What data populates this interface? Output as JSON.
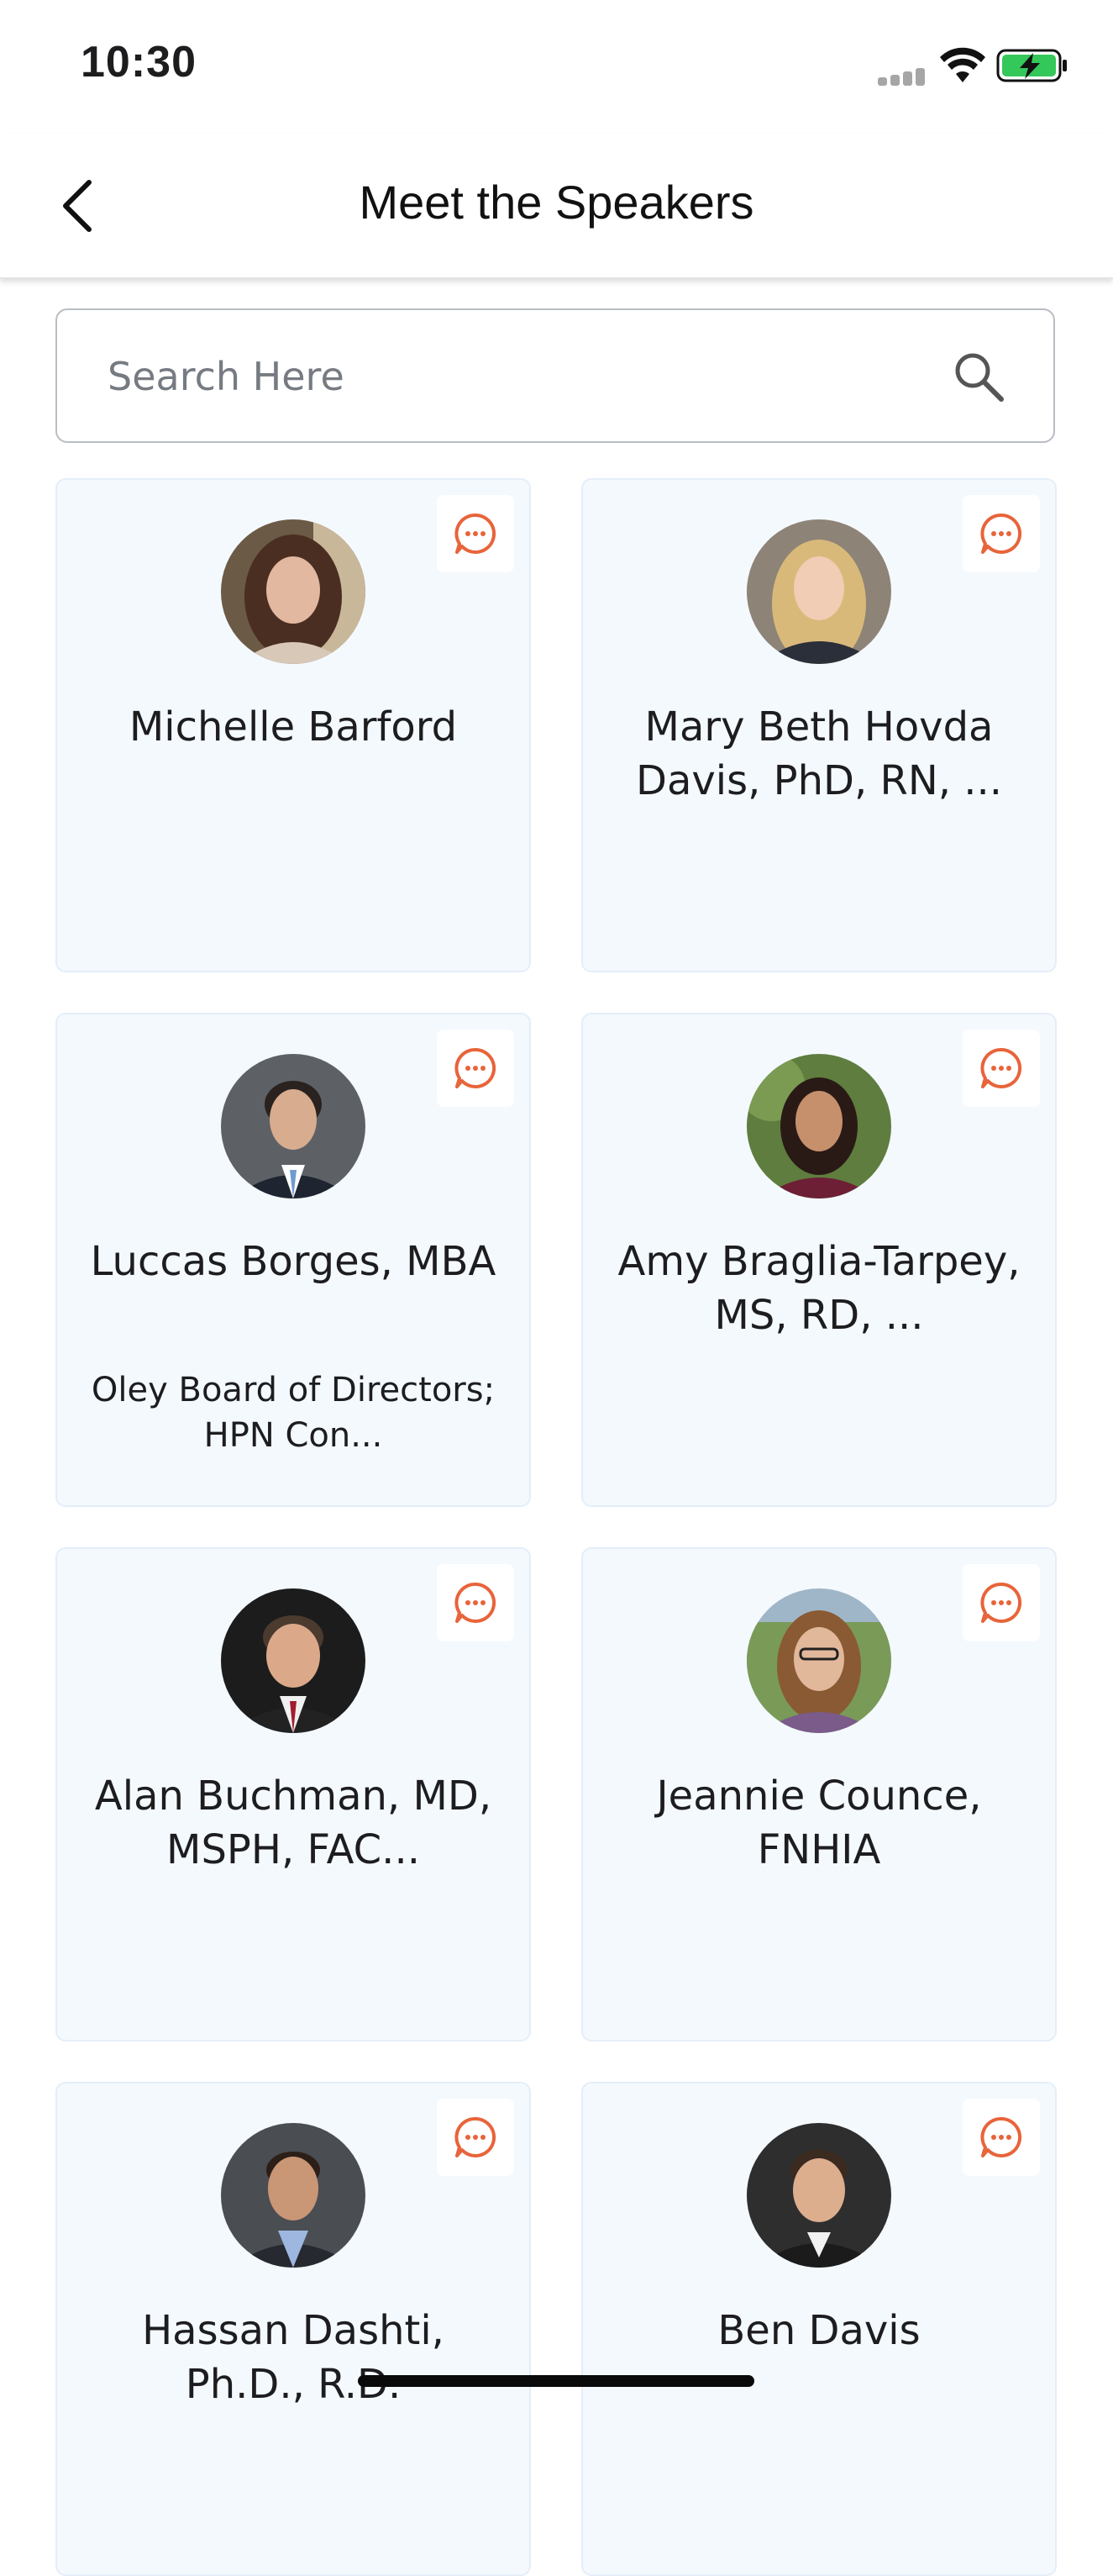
{
  "status_bar": {
    "time": "10:30"
  },
  "nav": {
    "title": "Meet the Speakers"
  },
  "search": {
    "placeholder": "Search Here"
  },
  "speakers": [
    {
      "name": "Michelle Barford",
      "subtitle": ""
    },
    {
      "name": "Mary Beth Hovda Davis, PhD, RN, ...",
      "subtitle": ""
    },
    {
      "name": "Luccas Borges, MBA",
      "subtitle": "Oley Board of Directors; HPN Con..."
    },
    {
      "name": "Amy Braglia-Tarpey, MS, RD, ...",
      "subtitle": ""
    },
    {
      "name": "Alan Buchman, MD, MSPH, FAC...",
      "subtitle": ""
    },
    {
      "name": "Jeannie  Counce, FNHIA",
      "subtitle": ""
    },
    {
      "name": "Hassan  Dashti, Ph.D., R.D.",
      "subtitle": ""
    },
    {
      "name": "Ben Davis",
      "subtitle": ""
    }
  ],
  "colors": {
    "accent": "#e8643a",
    "card_bg": "#f4f9fe",
    "battery": "#34c759"
  },
  "icons": {
    "back": "chevron-left-icon",
    "search": "search-icon",
    "chat": "chat-bubble-icon"
  }
}
